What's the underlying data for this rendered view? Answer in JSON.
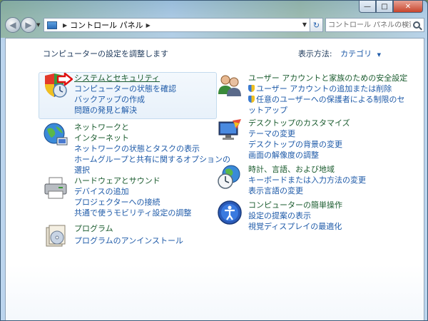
{
  "window": {
    "minimize": "—",
    "maximize": "□",
    "close": "✕"
  },
  "address": {
    "crumb": "コントロール パネル"
  },
  "search": {
    "placeholder": "コントロール パネルの検索"
  },
  "header": {
    "title": "コンピューターの設定を調整します",
    "view_by_label": "表示方法:",
    "view_by_value": "カテゴリ"
  },
  "categories": [
    {
      "title": "システムとセキュリティ",
      "icon": "shield-security-icon",
      "links": [
        "コンピューターの状態を確認",
        "バックアップの作成",
        "問題の発見と解決"
      ]
    },
    {
      "title": "ネットワークと",
      "title2": "インターネット",
      "icon": "network-globe-icon",
      "links": [
        "ネットワークの状態とタスクの表示",
        "ホームグループと共有に関するオプションの",
        "選択"
      ]
    },
    {
      "title": "ハードウェアとサウンド",
      "icon": "printer-icon",
      "links": [
        "デバイスの追加",
        "プロジェクターへの接続",
        "共通で使うモビリティ設定の調整"
      ]
    },
    {
      "title": "プログラム",
      "icon": "program-box-icon",
      "links": [
        "プログラムのアンインストール"
      ]
    },
    {
      "title": "ユーザー アカウントと家族のための安全設定",
      "icon": "users-icon",
      "links": [
        "ユーザー アカウントの追加または削除",
        "任意のユーザーへの保護者による制限のセ",
        "ットアップ"
      ]
    },
    {
      "title": "デスクトップのカスタマイズ",
      "icon": "monitor-paint-icon",
      "links": [
        "テーマの変更",
        "デスクトップの背景の変更",
        "画面の解像度の調整"
      ]
    },
    {
      "title": "時計、言語、および地域",
      "icon": "clock-globe-icon",
      "links": [
        "キーボードまたは入力方法の変更",
        "表示言語の変更"
      ]
    },
    {
      "title": "コンピューターの簡単操作",
      "icon": "ease-of-access-icon",
      "links": [
        "設定の提案の表示",
        "視覚ディスプレイの最適化"
      ]
    }
  ]
}
